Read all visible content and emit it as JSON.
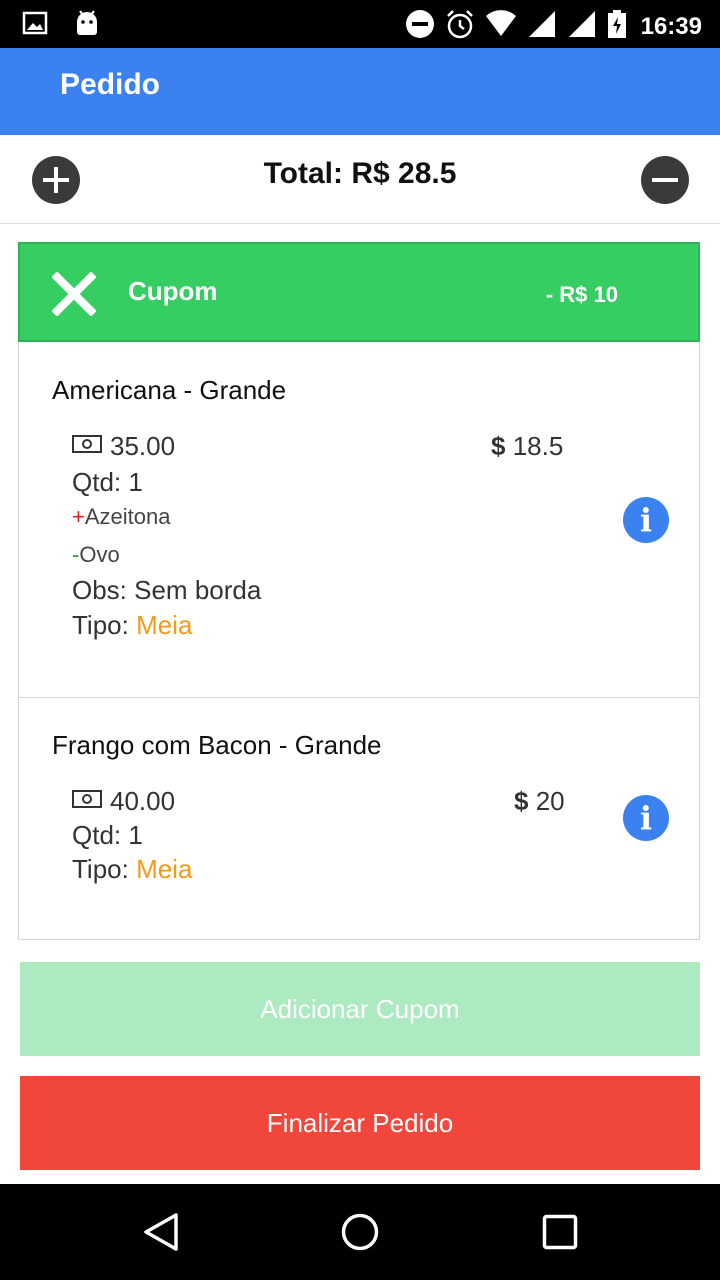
{
  "status_bar": {
    "time": "16:39"
  },
  "app_bar": {
    "title": "Pedido"
  },
  "total": {
    "text": "Total: R$ 28.5"
  },
  "coupon": {
    "label": "Cupom",
    "value": "- R$ 10"
  },
  "items": [
    {
      "name": "Americana - Grande",
      "base_price": "35.00",
      "price_symbol": "$",
      "price": "18.5",
      "qty": "Qtd: 1",
      "extra_add_sign": "+",
      "extra_add": "Azeitona",
      "extra_remove_sign": "-",
      "extra_remove": "Ovo",
      "obs": "Obs: Sem borda",
      "tipo_label": "Tipo: ",
      "tipo_value": "Meia",
      "info_icon": "i"
    },
    {
      "name": "Frango com Bacon - Grande",
      "base_price": "40.00",
      "price_symbol": "$",
      "price": "20",
      "qty": "Qtd: 1",
      "tipo_label": "Tipo: ",
      "tipo_value": "Meia",
      "info_icon": "i"
    }
  ],
  "buttons": {
    "add_coupon": "Adicionar Cupom",
    "finish": "Finalizar Pedido"
  },
  "colors": {
    "app_bar": "#3b82f0",
    "coupon": "#36ce62",
    "add_coupon_button": "#aeeac1",
    "finish_button": "#f0463c",
    "tipo_value": "#f39a1a"
  }
}
